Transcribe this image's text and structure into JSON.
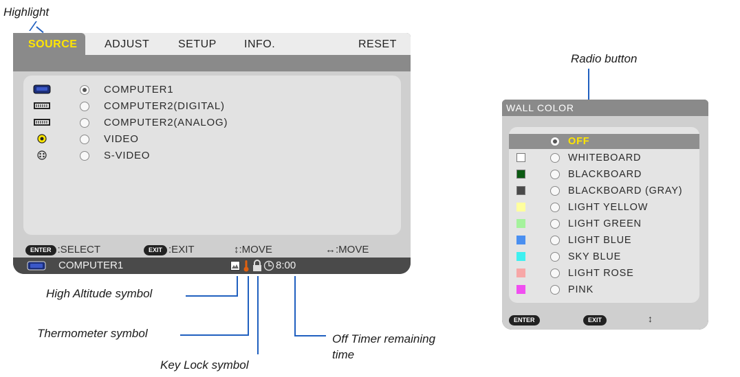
{
  "callouts": {
    "highlight": "Highlight",
    "radio_button": "Radio button",
    "high_altitude": "High Altitude symbol",
    "thermometer": "Thermometer symbol",
    "key_lock": "Key Lock symbol",
    "off_timer_line1": "Off Timer remaining",
    "off_timer_line2": "time"
  },
  "main_menu": {
    "tabs": [
      "SOURCE",
      "ADJUST",
      "SETUP",
      "INFO.",
      "RESET"
    ],
    "active_tab": "SOURCE",
    "items": [
      {
        "label": "COMPUTER1",
        "selected": true,
        "icon": "computer-port-icon"
      },
      {
        "label": "COMPUTER2(DIGITAL)",
        "selected": false,
        "icon": "dvi-port-icon"
      },
      {
        "label": "COMPUTER2(ANALOG)",
        "selected": false,
        "icon": "dvi-port-icon"
      },
      {
        "label": "VIDEO",
        "selected": false,
        "icon": "rca-jack-icon"
      },
      {
        "label": "S-VIDEO",
        "selected": false,
        "icon": "svideo-jack-icon"
      }
    ],
    "help": {
      "enter_key": "ENTER",
      "enter_text": ":SELECT",
      "exit_key": "EXIT",
      "exit_text": ":EXIT",
      "updown_text": "↕:MOVE",
      "leftright_text": "↔:MOVE"
    },
    "status": {
      "source": "COMPUTER1",
      "timer": "8:00"
    }
  },
  "wall_color": {
    "title": "WALL COLOR",
    "items": [
      {
        "label": "OFF",
        "selected": true,
        "swatch": null
      },
      {
        "label": "WHITEBOARD",
        "selected": false,
        "swatch": "#ffffff"
      },
      {
        "label": "BLACKBOARD",
        "selected": false,
        "swatch": "#0b5a12"
      },
      {
        "label": "BLACKBOARD (GRAY)",
        "selected": false,
        "swatch": "#4a4a4a"
      },
      {
        "label": "LIGHT YELLOW",
        "selected": false,
        "swatch": "#ffff9e"
      },
      {
        "label": "LIGHT GREEN",
        "selected": false,
        "swatch": "#a4f29c"
      },
      {
        "label": "LIGHT BLUE",
        "selected": false,
        "swatch": "#4a8ff0"
      },
      {
        "label": "SKY BLUE",
        "selected": false,
        "swatch": "#3ff0f0"
      },
      {
        "label": "LIGHT ROSE",
        "selected": false,
        "swatch": "#f7a7a7"
      },
      {
        "label": "PINK",
        "selected": false,
        "swatch": "#f04ff0"
      }
    ],
    "footer": {
      "enter_key": "ENTER",
      "exit_key": "EXIT",
      "updown": "↕"
    }
  },
  "colors": {
    "highlight_text": "#ffe600",
    "callout_line": "#1f5fbf",
    "thermometer": "#e06010"
  }
}
